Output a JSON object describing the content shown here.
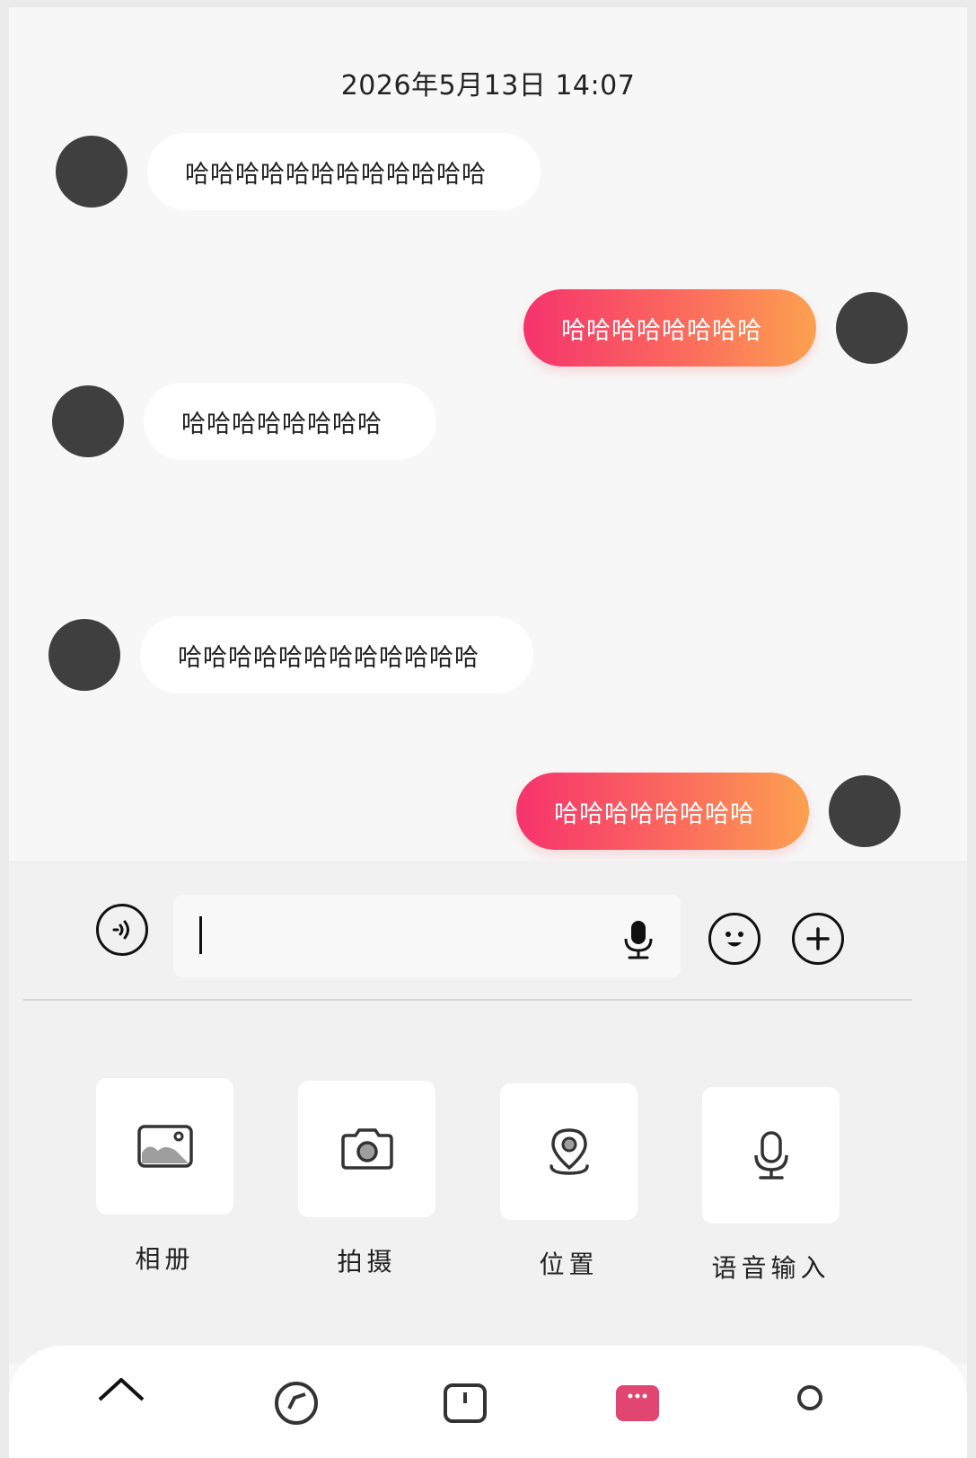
{
  "conversation": {
    "timestamp": "2026年5月13日 14:07",
    "messages": [
      {
        "side": "in",
        "text": "哈哈哈哈哈哈哈哈哈哈哈哈"
      },
      {
        "side": "out",
        "text": "哈哈哈哈哈哈哈哈"
      },
      {
        "side": "in",
        "text": "哈哈哈哈哈哈哈哈"
      },
      {
        "side": "in",
        "text": "哈哈哈哈哈哈哈哈哈哈哈哈"
      },
      {
        "side": "out",
        "text": "哈哈哈哈哈哈哈哈"
      }
    ]
  },
  "composer": {
    "input_value": "",
    "icons": [
      "voice-toggle-icon",
      "microphone-icon",
      "emoji-icon",
      "plus-icon"
    ]
  },
  "tools": [
    {
      "label": "相册",
      "icon": "photo-album-icon"
    },
    {
      "label": "拍摄",
      "icon": "camera-icon"
    },
    {
      "label": "位置",
      "icon": "location-icon"
    },
    {
      "label": "语音输入",
      "icon": "microphone-icon"
    }
  ],
  "nav": {
    "icons": [
      "home-icon",
      "discover-icon",
      "add-icon",
      "messages-icon",
      "profile-icon"
    ]
  },
  "colors": {
    "outgoing_gradient_start": "#f6336d",
    "outgoing_gradient_end": "#fca150",
    "avatar": "#3f3f3f"
  }
}
